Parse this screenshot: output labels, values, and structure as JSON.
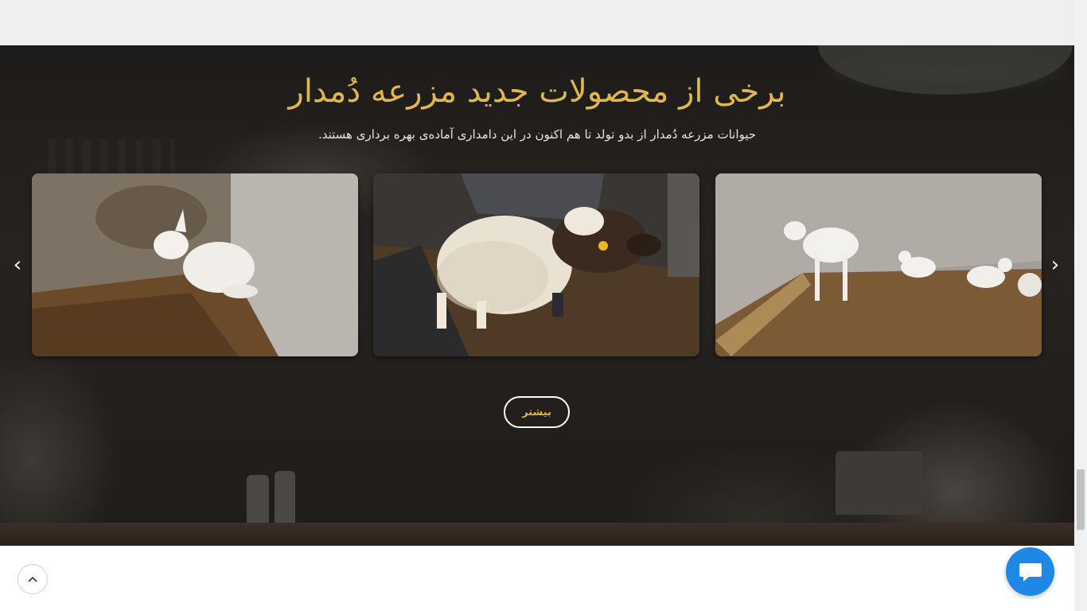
{
  "section": {
    "title": "برخی از محصولات جدید مزرعه دُمدار",
    "subtitle": "حیوانات مزرعه دُمدار از بدو تولد تا هم اکنون در این دامداری آماده‌ی بهره برداری هستند.",
    "more_button_label": "بیشتر"
  },
  "carousel": {
    "prev_icon": "chevron-left-icon",
    "next_icon": "chevron-right-icon",
    "prev_glyph": "‹",
    "next_glyph": "›",
    "items": [
      {
        "subject": "kid-goat-lying"
      },
      {
        "subject": "sheep-being-held"
      },
      {
        "subject": "goats-standing"
      }
    ]
  },
  "widgets": {
    "scroll_top_icon": "chevron-up-icon",
    "scroll_top_glyph": "︿",
    "chat_icon": "chat-bubble-icon"
  },
  "colors": {
    "title_gold": "#e2b64c",
    "chat_blue": "#1e88e5",
    "hero_dark": "#1f1c1a"
  }
}
